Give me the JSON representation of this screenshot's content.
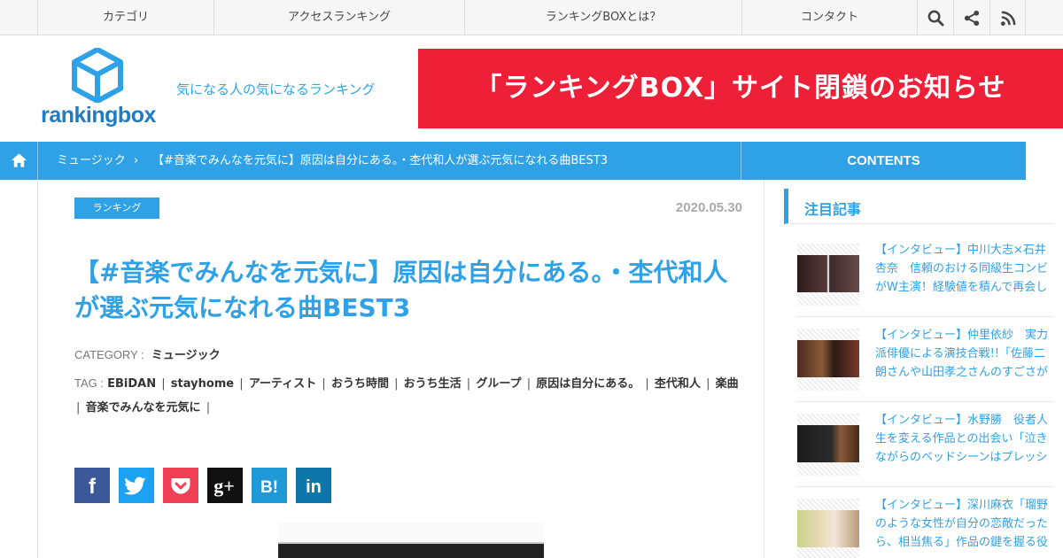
{
  "topnav": {
    "items": [
      "カテゴリ",
      "アクセスランキング",
      "ランキングBOXとは？",
      "コンタクト"
    ],
    "icons": [
      "search-icon",
      "share-icon",
      "rss-icon"
    ]
  },
  "header": {
    "logo_text": "rankingbox",
    "tagline": "気になる人の気になるランキング",
    "banner": "「ランキングBOX」サイト閉鎖のお知らせ"
  },
  "breadcrumb": {
    "home_icon": "home-icon",
    "items": [
      "ミュージック",
      "【#音楽でみんなを元気に】原因は自分にある。・杢代和人が選ぶ元気になれる曲BEST3"
    ],
    "separator": "›",
    "contents_label": "CONTENTS"
  },
  "article": {
    "category_badge": "ランキング",
    "date": "2020.05.30",
    "title": "【#音楽でみんなを元気に】原因は自分にある。・杢代和人が選ぶ元気になれる曲BEST3",
    "category_label": "CATEGORY :",
    "category_value": "ミュージック",
    "tags_label": "TAG :",
    "tags": [
      "EBiDAN",
      "stayhome",
      "アーティスト",
      "おうち時間",
      "おうち生活",
      "グループ",
      "原因は自分にある。",
      "杢代和人",
      "楽曲",
      "音楽でみんなを元気に"
    ],
    "tag_separator": "|",
    "share_buttons": [
      {
        "icon": "facebook-icon",
        "color": "#3b5998"
      },
      {
        "icon": "twitter-icon",
        "color": "#1da1f2"
      },
      {
        "icon": "pocket-icon",
        "color": "#ef4056"
      },
      {
        "icon": "google-plus-icon",
        "color": "#111111"
      },
      {
        "icon": "hatena-bookmark-icon",
        "color": "#1f9ad6"
      },
      {
        "icon": "linkedin-icon",
        "color": "#0e76a8"
      }
    ]
  },
  "sidebar": {
    "heading": "注目記事",
    "items": [
      {
        "text": "【インタビュー】中川大志×石井杏奈　信頼のおける同級生コンビがW主演！経験値を積んで再会し"
      },
      {
        "text": "【インタビュー】仲里依紗　実力派俳優による演技合戦!!「佐藤二朗さんや山田孝之さんのすごさが"
      },
      {
        "text": "【インタビュー】水野勝　役者人生を変える作品との出会い「泣きながらのベッドシーンはプレッシ"
      },
      {
        "text": "【インタビュー】深川麻衣「瑠野のような女性が自分の恋敵だったら、相当焦る」作品の鍵を握る役"
      }
    ]
  },
  "colors": {
    "accent": "#2fa1e6",
    "banner_red": "#ee2038",
    "logo_blue": "#1f7cc4"
  }
}
